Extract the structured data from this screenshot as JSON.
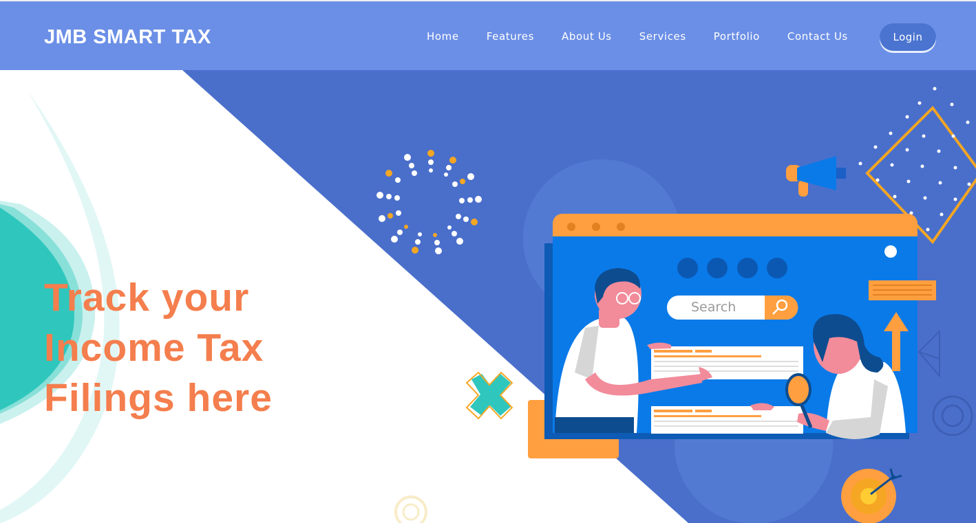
{
  "header": {
    "brand": "JMB SMART TAX",
    "nav": [
      "Home",
      "Features",
      "About Us",
      "Services",
      "Portfolio",
      "Contact Us"
    ],
    "login_label": "Login"
  },
  "hero": {
    "headline_lines": [
      "Track your",
      "Income Tax",
      "Filings here"
    ],
    "search_placeholder": "Search"
  },
  "colors": {
    "nav_bg": "#6b8fe6",
    "hero_blue": "#4a6fcb",
    "accent_orange": "#f47e4d",
    "teal": "#2fc7bd",
    "screen_blue": "#0a7ae8",
    "browser_bar": "#ff9f3f"
  },
  "icons": [
    "search-icon",
    "megaphone-icon",
    "magnifier-icon",
    "up-arrow-icon",
    "target-icon",
    "paper-plane-icon",
    "x-mark-icon"
  ]
}
